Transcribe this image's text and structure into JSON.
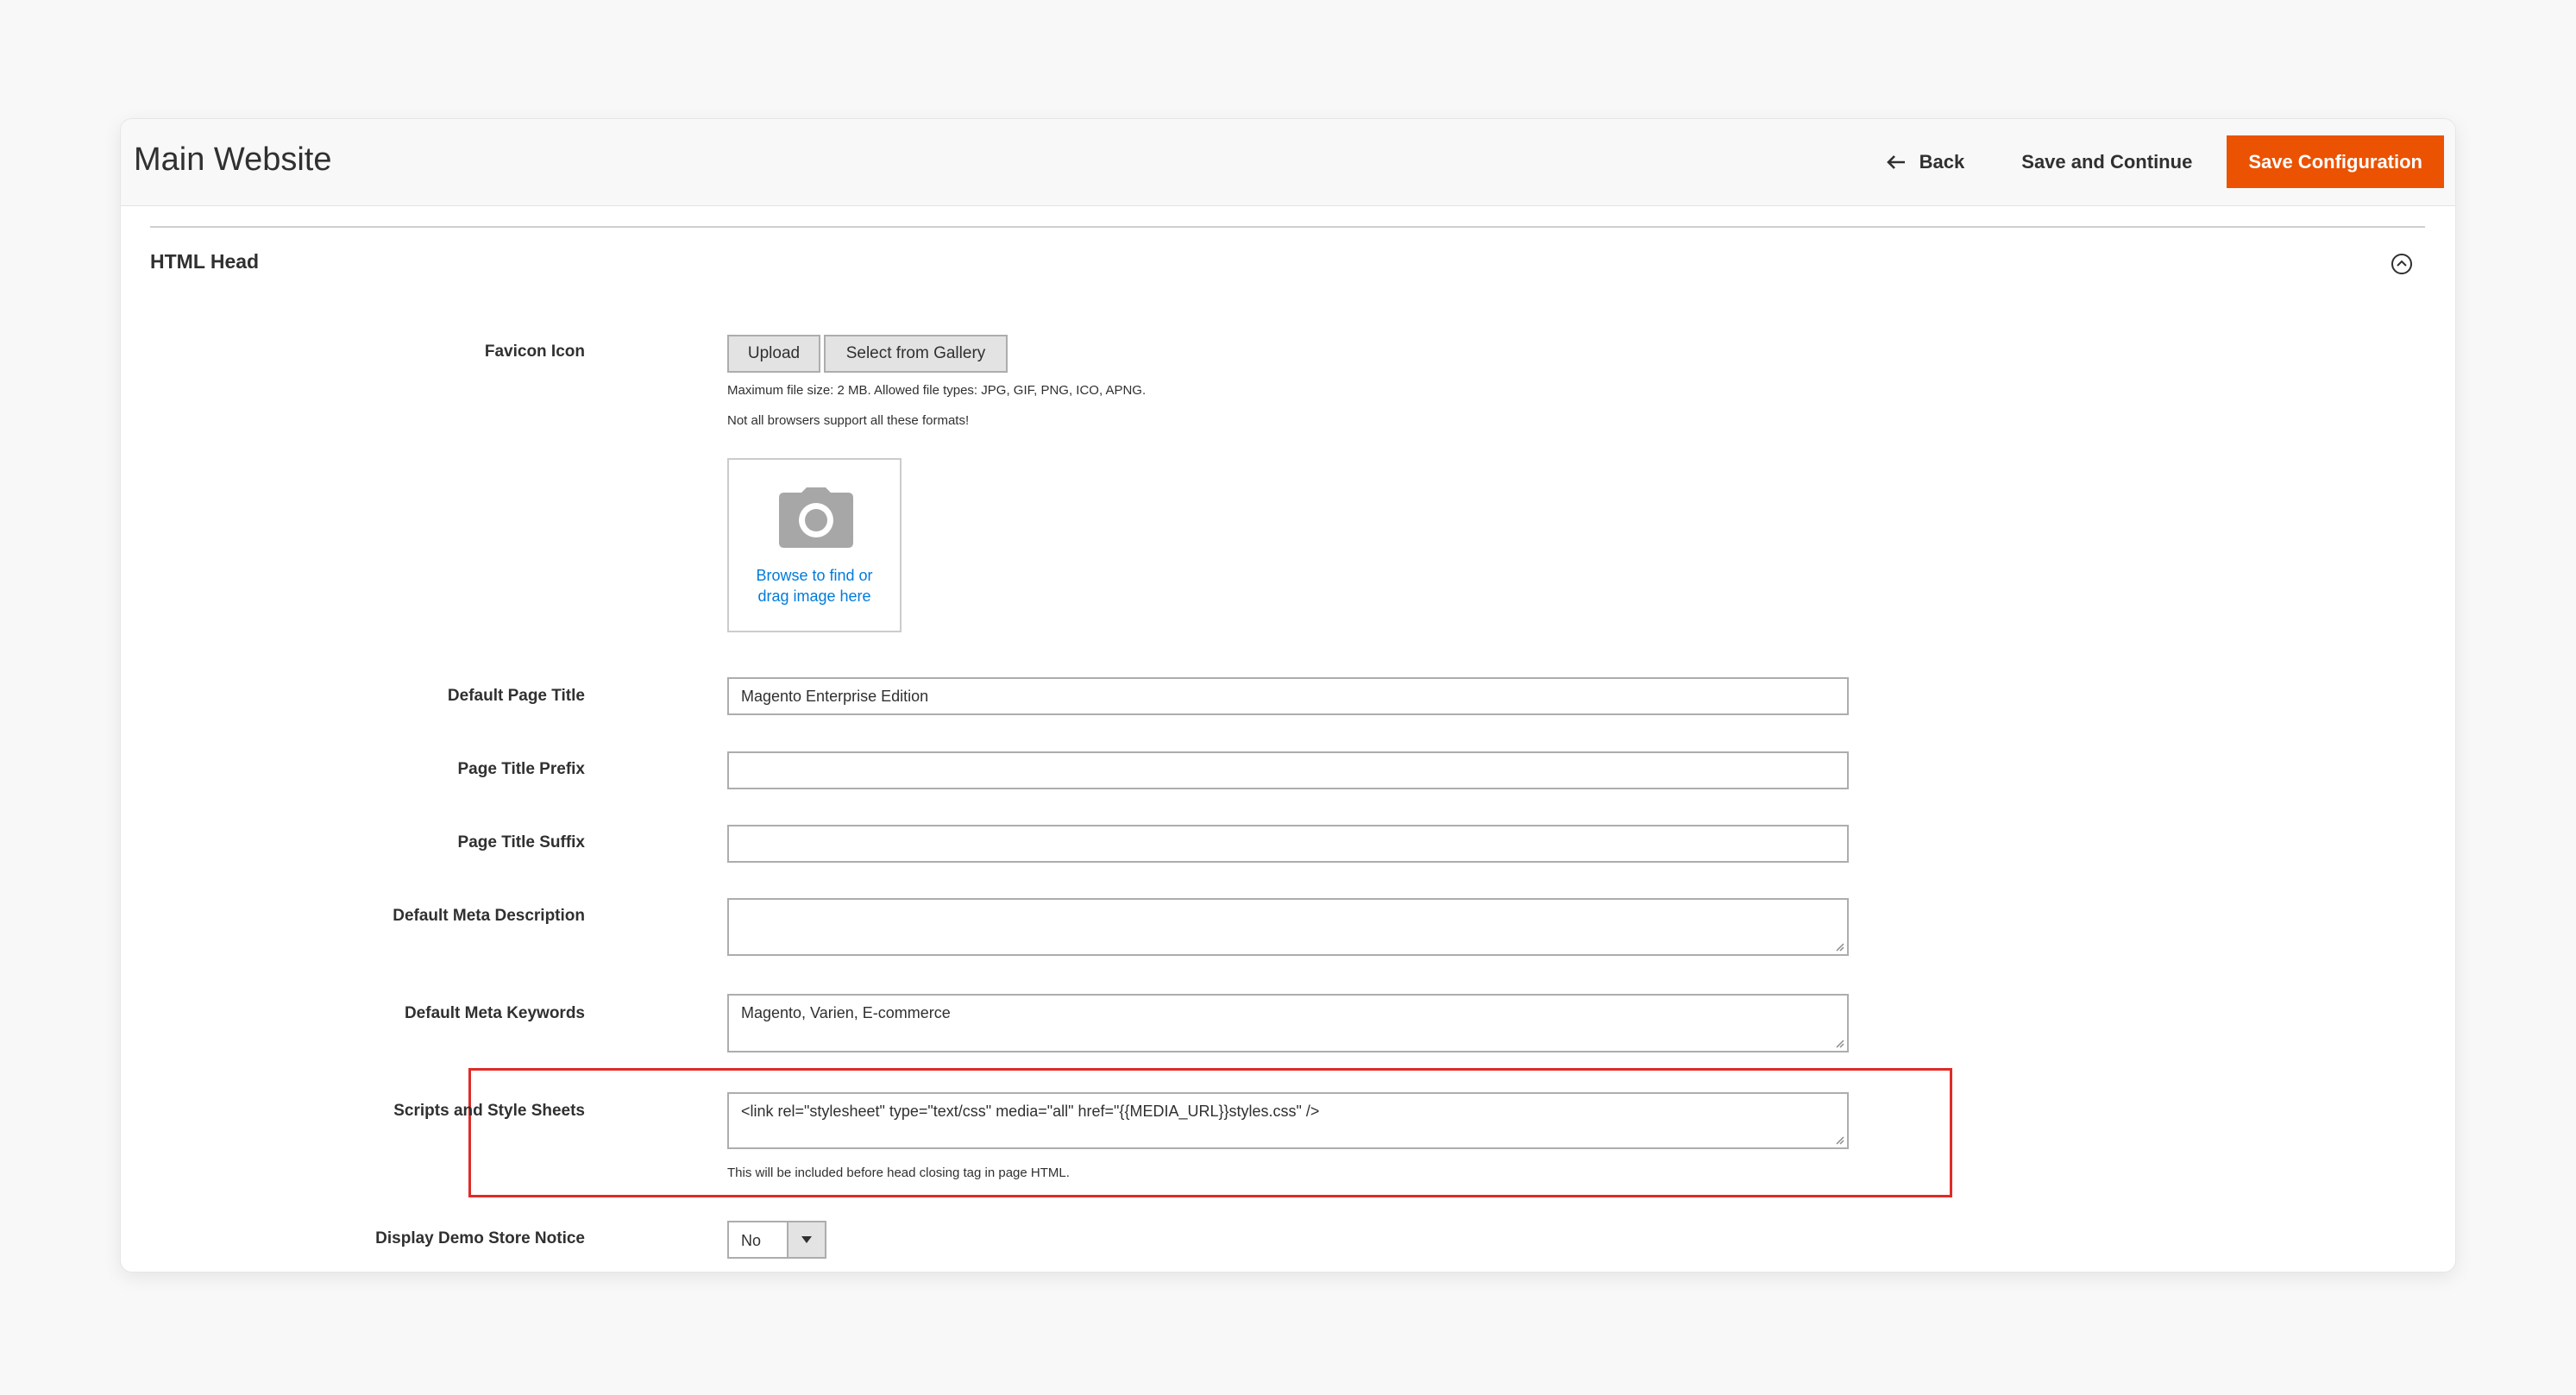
{
  "header": {
    "title": "Main Website",
    "back_label": "Back",
    "save_continue_label": "Save and Continue",
    "save_config_label": "Save Configuration"
  },
  "section": {
    "title": "HTML Head"
  },
  "fields": {
    "favicon": {
      "label": "Favicon Icon",
      "upload_label": "Upload",
      "gallery_label": "Select from Gallery",
      "note1": "Maximum file size: 2 MB. Allowed file types: JPG, GIF, PNG, ICO, APNG.",
      "note2": "Not all browsers support all these formats!",
      "dropzone_line1": "Browse to find or",
      "dropzone_line2": "drag image here"
    },
    "default_title": {
      "label": "Default Page Title",
      "value": "Magento Enterprise Edition"
    },
    "title_prefix": {
      "label": "Page Title Prefix",
      "value": ""
    },
    "title_suffix": {
      "label": "Page Title Suffix",
      "value": ""
    },
    "meta_description": {
      "label": "Default Meta Description",
      "value": ""
    },
    "meta_keywords": {
      "label": "Default Meta Keywords",
      "value": "Magento, Varien, E-commerce"
    },
    "scripts": {
      "label": "Scripts and Style Sheets",
      "value": "<link  rel=\"stylesheet\" type=\"text/css\"  media=\"all\" href=\"{{MEDIA_URL}}styles.css\" />",
      "note": "This will be included before head closing tag in page HTML."
    },
    "demo_notice": {
      "label": "Display Demo Store Notice",
      "value": "No"
    }
  },
  "colors": {
    "accent": "#eb5202",
    "highlight": "#e02b27",
    "link": "#007bdb"
  }
}
